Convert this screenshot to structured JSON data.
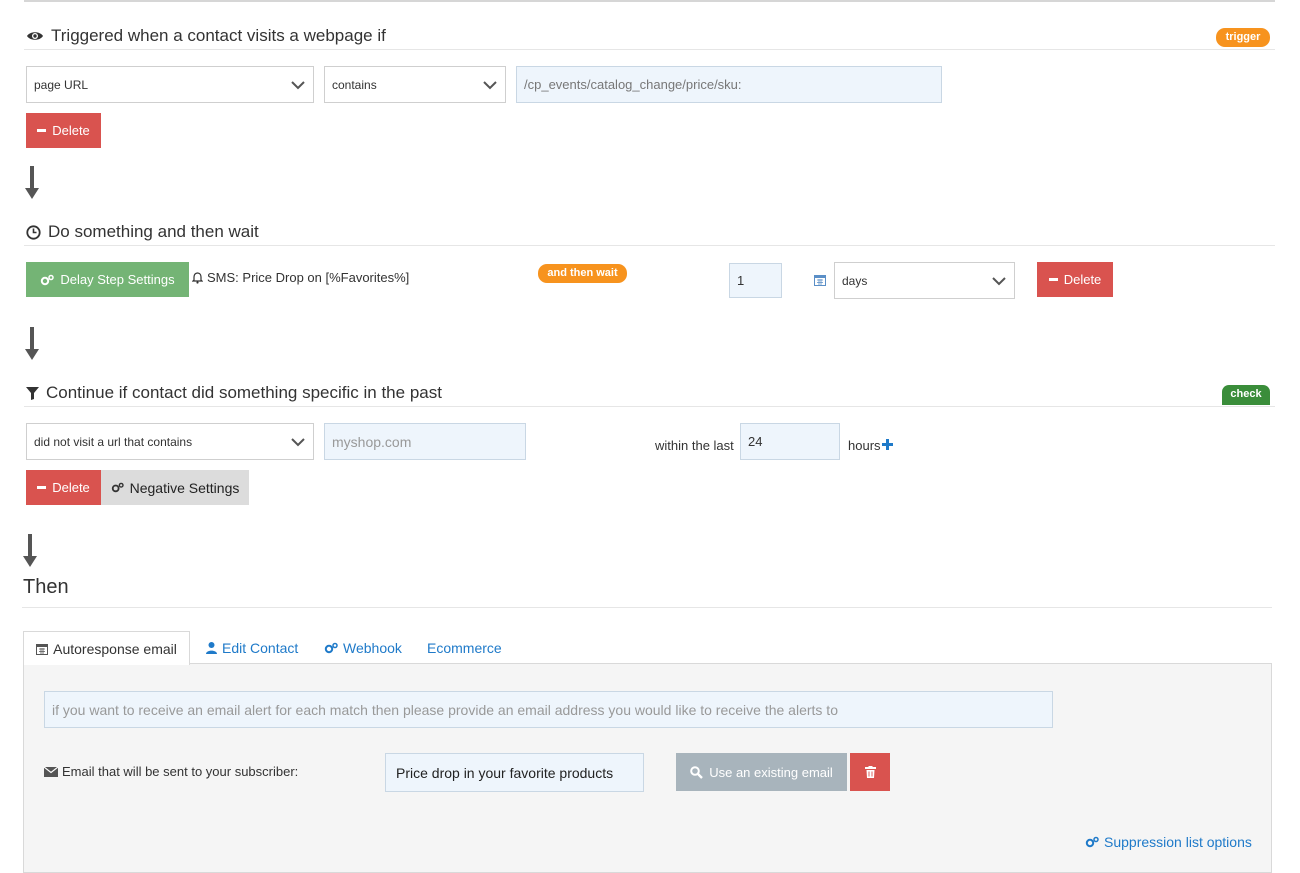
{
  "trigger": {
    "title": "Triggered when a contact visits a webpage if",
    "badge": "trigger",
    "field_select": "page URL",
    "operator_select": "contains",
    "value": "/cp_events/catalog_change/price/sku:",
    "delete_label": "Delete"
  },
  "delay": {
    "title": "Do something and then wait",
    "settings_label": "Delay Step Settings",
    "sms_label": "SMS: Price Drop on [%Favorites%]",
    "wait_badge": "and then wait",
    "amount": "1",
    "unit_select": "days",
    "delete_label": "Delete"
  },
  "check": {
    "title": "Continue if contact did something specific in the past",
    "badge": "check",
    "condition_select": "did not visit a url that contains",
    "url_placeholder": "myshop.com",
    "within_label": "within the last",
    "hours_value": "24",
    "hours_label": "hours",
    "delete_label": "Delete",
    "negative_label": "Negative Settings"
  },
  "then": {
    "title": "Then",
    "tabs": [
      {
        "label": "Autoresponse email",
        "icon": "calendar-icon"
      },
      {
        "label": "Edit Contact",
        "icon": "user-icon"
      },
      {
        "label": "Webhook",
        "icon": "gears-icon"
      },
      {
        "label": "Ecommerce",
        "icon": ""
      }
    ],
    "alert_placeholder": "if you want to receive an email alert for each match then please provide an email address you would like to receive the alerts to",
    "email_label": "Email that will be sent to your subscriber:",
    "email_value": "Price drop in your favorite products",
    "use_existing_label": "Use an existing email",
    "suppression_label": "Suppression list options"
  },
  "colors": {
    "accent_orange": "#f7931e",
    "danger_red": "#d9534f",
    "success_green": "#74b475",
    "check_green": "#3a8d3a",
    "link_blue": "#1f7ac9"
  }
}
